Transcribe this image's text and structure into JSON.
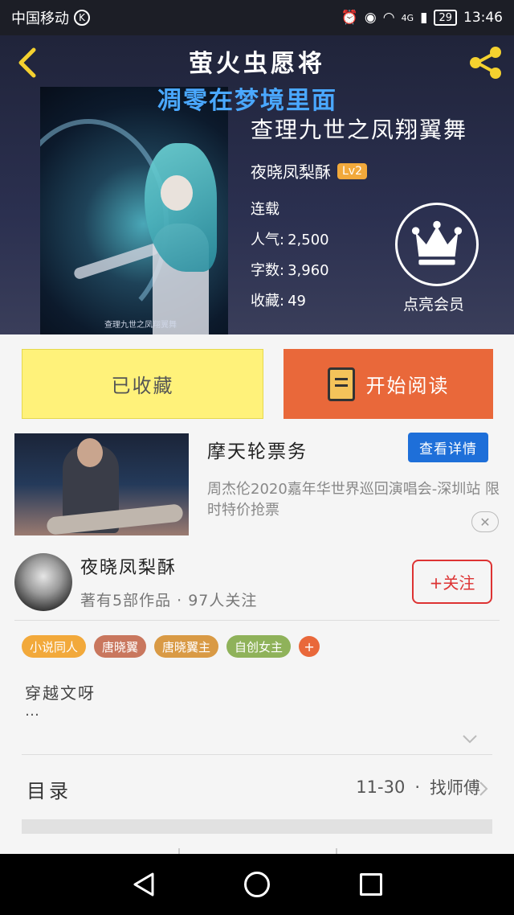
{
  "status_bar": {
    "carrier": "中国移动",
    "k_badge": "K",
    "network": "4G",
    "battery": "29",
    "time": "13:46"
  },
  "header": {
    "title": "萤火虫愿将",
    "subtitle": "凋零在梦境里面",
    "cover_caption": "查理九世之凤翔翼舞",
    "book_title": "查理九世之凤翔翼舞",
    "author": "夜晓凤梨酥",
    "level": "Lv2",
    "status": "连载",
    "popularity_label": "人气:",
    "popularity": "2,500",
    "wordcount_label": "字数:",
    "wordcount": "3,960",
    "favorites_label": "收藏:",
    "favorites": "49",
    "vip_label": "点亮会员"
  },
  "actions": {
    "collected_label": "已收藏",
    "read_label": "开始阅读"
  },
  "ad": {
    "title": "摩天轮票务",
    "detail_button": "查看详情",
    "description": "周杰伦2020嘉年华世界巡回演唱会-深圳站 限时特价抢票",
    "close": "✕"
  },
  "author_card": {
    "name": "夜晓凤梨酥",
    "stats": "著有5部作品 · 97人关注",
    "follow_button": "+关注"
  },
  "tags": [
    {
      "label": "小说同人",
      "color": "#f2a93b"
    },
    {
      "label": "唐晓翼",
      "color": "#c9775e"
    },
    {
      "label": "唐晓翼主",
      "color": "#d99a45"
    },
    {
      "label": "自创女主",
      "color": "#8fb25a"
    }
  ],
  "tag_add": "+",
  "description": {
    "text": "穿越文呀",
    "more": "…"
  },
  "catalog": {
    "label": "目录",
    "latest_date": "11-30",
    "separator": "·",
    "latest_chapter": "找师傅"
  },
  "colors": {
    "accent_orange": "#e9683a",
    "collected_yellow": "#fff27a",
    "detail_blue": "#1e6fd9",
    "follow_red": "#dd3333",
    "subtitle_blue": "#4aa8ff"
  }
}
